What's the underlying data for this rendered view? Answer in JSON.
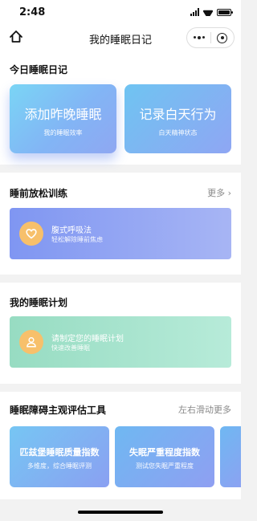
{
  "status_bar": {
    "time": "2:48"
  },
  "nav": {
    "title": "我的睡眠日记"
  },
  "diary": {
    "title": "今日睡眠日记",
    "cards": [
      {
        "title": "添加昨晚睡眠",
        "subtitle": "我的睡眠效率"
      },
      {
        "title": "记录白天行为",
        "subtitle": "白天精神状态"
      }
    ]
  },
  "relax": {
    "title": "睡前放松训练",
    "more": "更多",
    "card": {
      "title": "腹式呼吸法",
      "subtitle": "轻松解除睡前焦虑",
      "icon": "heart-icon"
    }
  },
  "plan": {
    "title": "我的睡眠计划",
    "card": {
      "title": "请制定您的睡眠计划",
      "subtitle": "快速改善睡眠",
      "icon": "person-icon"
    }
  },
  "tools": {
    "title": "睡眠障碍主观评估工具",
    "more": "左右滑动更多",
    "cards": [
      {
        "title": "匹兹堡睡眠质量指数",
        "subtitle": "多维度，综合睡眠评测"
      },
      {
        "title": "失眠严重程度指数",
        "subtitle": "测试您失眠严重程度"
      }
    ]
  },
  "colors": {
    "breath_icon_bg": "#f7c06b",
    "plan_icon_bg": "#f7c06b",
    "page_bg": "#f2f2f2"
  }
}
